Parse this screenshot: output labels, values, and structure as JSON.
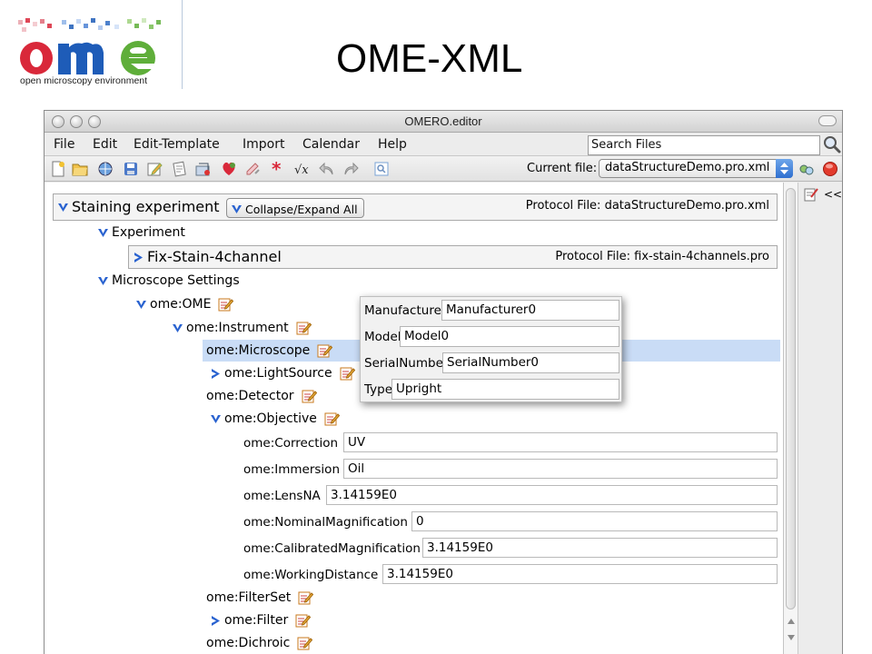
{
  "slide": {
    "logo_text": "ome",
    "logo_tagline": "open microscopy environment",
    "title": "OME-XML"
  },
  "window": {
    "title": "OMERO.editor"
  },
  "menu": [
    "File",
    "Edit",
    "Edit-Template",
    "Import",
    "Calendar",
    "Help"
  ],
  "search": {
    "value": "Search Files",
    "icon": "magnifier-icon"
  },
  "toolbar": {
    "current_file_label": "Current file:",
    "current_file": "dataStructureDemo.pro.xml",
    "tools": [
      "new-file-icon",
      "open-file-icon",
      "open-www-icon",
      "save-icon",
      "save-as-icon",
      "print-icon",
      "import-icon",
      "add-field-icon",
      "delete-field-icon",
      "required-star-icon",
      "formula-icon",
      "undo-icon",
      "redo-icon",
      "validate-icon"
    ],
    "right_icons": [
      "filter-icon",
      "close-file-icon"
    ]
  },
  "side_panel": {
    "collapse_label": "<<"
  },
  "tree": {
    "root": {
      "title": "Staining experiment",
      "collapse_button": "Collapse/Expand All",
      "protocol_file": "Protocol File: dataStructureDemo.pro.xml"
    },
    "experiment": "Experiment",
    "fix_stain": {
      "title": "Fix-Stain-4channel",
      "protocol_file": "Protocol File: fix-stain-4channels.pro"
    },
    "microscope_settings": "Microscope Settings",
    "ome_ome": "ome:OME",
    "ome_instrument": "ome:Instrument",
    "ome_microscope": "ome:Microscope",
    "ome_lightsource": "ome:LightSource",
    "ome_detector": "ome:Detector",
    "ome_objective": "ome:Objective",
    "objective_fields": [
      {
        "label": "ome:Correction",
        "value": "UV"
      },
      {
        "label": "ome:Immersion",
        "value": "Oil"
      },
      {
        "label": "ome:LensNA",
        "value": "3.14159E0"
      },
      {
        "label": "ome:NominalMagnification",
        "value": "0"
      },
      {
        "label": "ome:CalibratedMagnification",
        "value": "3.14159E0"
      },
      {
        "label": "ome:WorkingDistance",
        "value": "3.14159E0"
      }
    ],
    "ome_filterset": "ome:FilterSet",
    "ome_filter": "ome:Filter",
    "ome_dichroic": "ome:Dichroic"
  },
  "popup": {
    "fields": [
      {
        "label": "Manufacturer",
        "value": "Manufacturer0"
      },
      {
        "label": "Model",
        "value": "Model0"
      },
      {
        "label": "SerialNumber",
        "value": "SerialNumber0"
      },
      {
        "label": "Type",
        "value": "Upright"
      }
    ]
  },
  "colors": {
    "selected_row": "#c9dcf6",
    "chevron_blue": "#2a63d0",
    "logo_red": "#d9283a",
    "logo_blue": "#1e5cb8",
    "logo_green": "#5fae3a"
  }
}
